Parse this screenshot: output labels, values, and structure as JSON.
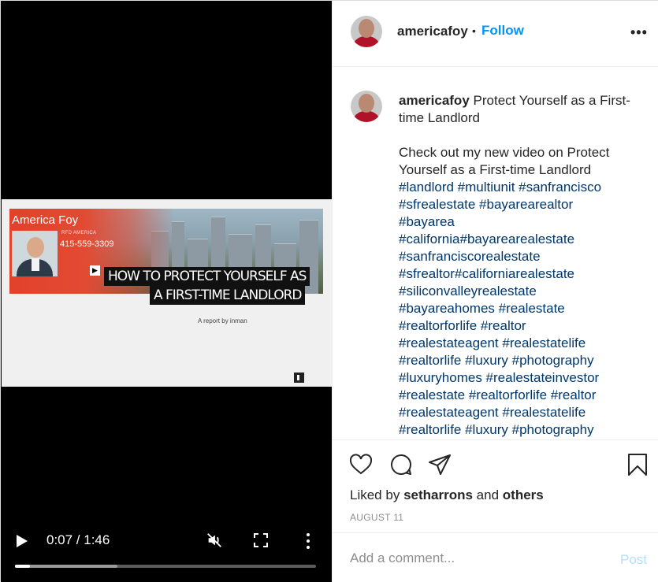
{
  "video": {
    "thumbnail": {
      "agent_name": "America Foy",
      "agent_company": "RFD AMERICA",
      "agent_phone": "415-559-3309",
      "headline_line1": "HOW TO PROTECT YOURSELF AS",
      "headline_line2": "A FIRST-TIME LANDLORD",
      "report_by": "A report by inman"
    },
    "controls": {
      "time": "0:07 / 1:46",
      "played_fraction": 0.05,
      "buffered_fraction": 0.34,
      "muted": true
    }
  },
  "header": {
    "username": "americafoy",
    "separator": "•",
    "follow_label": "Follow",
    "more_label": "•••"
  },
  "caption": {
    "username": "americafoy",
    "title": "Protect Yourself as a First-time Landlord",
    "body": "Check out my new video on Protect Yourself as a First-time Landlord",
    "hashtags": [
      "#landlord #multiunit #sanfrancisco",
      "#sfrealestate #bayarearealtor",
      "#bayarea",
      "#california#bayarearealestate",
      "#sanfranciscorealestate",
      "#sfrealtor#californiarealestate",
      "#siliconvalleyrealestate",
      "#bayareahomes #realestate",
      "#realtorforlife #realtor",
      "#realestateagent #realestatelife",
      "#realtorlife #luxury #photography",
      "#luxuryhomes #realestateinvestor",
      "#realestate #realtorforlife #realtor",
      "#realestateagent #realestatelife",
      "#realtorlife #luxury #photography"
    ]
  },
  "likes": {
    "prefix": "Liked by",
    "user": "setharrons",
    "and": "and",
    "others": "others"
  },
  "date": "AUGUST 11",
  "comment": {
    "placeholder": "Add a comment...",
    "post_label": "Post"
  },
  "colors": {
    "follow": "#0095f6",
    "hashtag": "#00376b",
    "post_disabled": "#b2dffc",
    "banner_red": "#e2412b"
  },
  "icons": [
    "heart-icon",
    "comment-icon",
    "share-icon",
    "bookmark-icon",
    "play-icon",
    "muted-icon",
    "fullscreen-icon",
    "more-vertical-icon"
  ]
}
